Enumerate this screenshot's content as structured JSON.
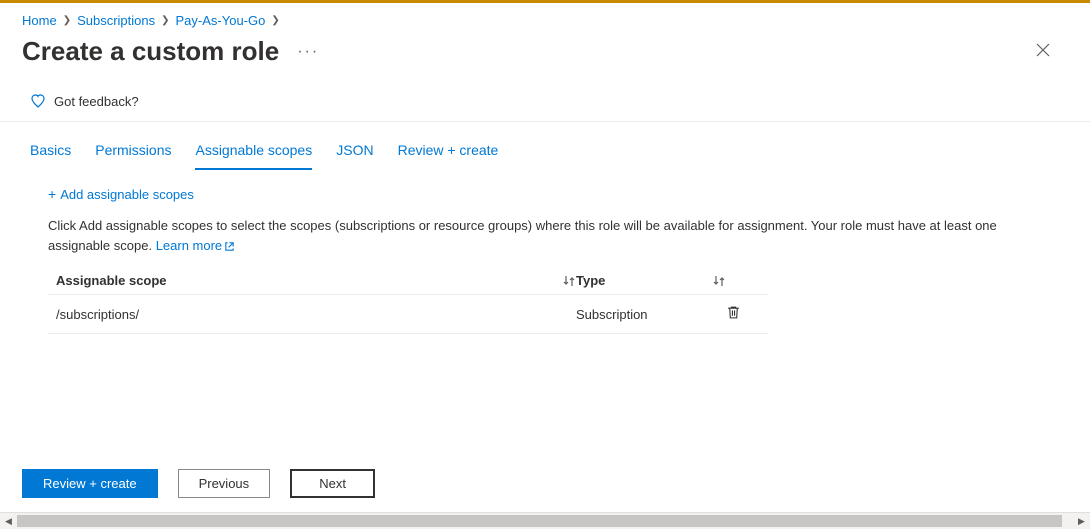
{
  "breadcrumb": {
    "items": [
      {
        "label": "Home"
      },
      {
        "label": "Subscriptions"
      },
      {
        "label": "Pay-As-You-Go"
      }
    ]
  },
  "page": {
    "title": "Create a custom role",
    "feedback_label": "Got feedback?"
  },
  "tabs": [
    {
      "label": "Basics"
    },
    {
      "label": "Permissions"
    },
    {
      "label": "Assignable scopes"
    },
    {
      "label": "JSON"
    },
    {
      "label": "Review + create"
    }
  ],
  "content": {
    "add_link": "Add assignable scopes",
    "help_text": "Click Add assignable scopes to select the scopes (subscriptions or resource groups) where this role will be available for assignment. Your role must have at least one assignable scope. ",
    "learn_more": "Learn more",
    "table": {
      "col_scope": "Assignable scope",
      "col_type": "Type",
      "rows": [
        {
          "scope": "/subscriptions/",
          "type": "Subscription"
        }
      ]
    }
  },
  "footer": {
    "review": "Review + create",
    "previous": "Previous",
    "next": "Next"
  }
}
